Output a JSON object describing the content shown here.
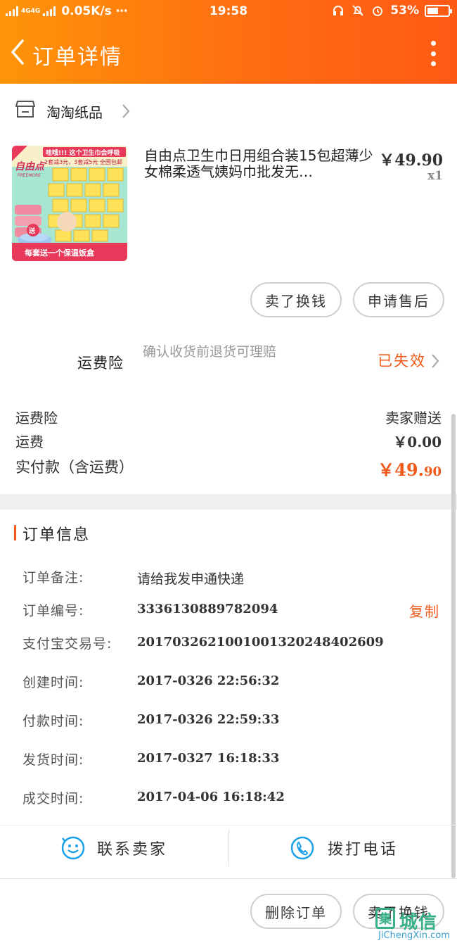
{
  "status_bar": {
    "net_top": "2G",
    "net_mid": "4G4G",
    "speed": "0.05K/s ⋯",
    "time": "19:58",
    "battery": "53%",
    "battery_level": 0.53
  },
  "nav": {
    "title": "订单详情"
  },
  "shop": {
    "name": "淘淘纸品"
  },
  "product": {
    "image_text_top": "哇哦!!! 这个卫生巾会呼吸",
    "image_text_mid": "2套减3元，3套减5元  全国包邮",
    "image_brand": "自由点",
    "image_brand_en": "FREEMORE",
    "image_badge": "送",
    "image_text_bottom": "每套送一个保温饭盒",
    "title": "自由点卫生巾日用组合装15包超薄少女棉柔透气姨妈巾批发无…",
    "price": "￥49.90",
    "qty": "x1"
  },
  "actions": {
    "sell_label": "卖了换钱",
    "after_sale_label": "申请售后"
  },
  "insurance": {
    "label": "运费险",
    "desc": "确认收货前退货可理赔",
    "status": "已失效"
  },
  "cost": {
    "insurance_label": "运费险",
    "insurance_value": "卖家赠送",
    "shipping_label": "运费",
    "shipping_value": "￥0.00",
    "total_label": "实付款（含运费）",
    "total_value_main": "￥49.",
    "total_value_decimal": "90"
  },
  "order_info": {
    "heading": "订单信息",
    "copy_label": "复制",
    "rows": [
      {
        "key": "订单备注:",
        "value": "请给我发申通快递"
      },
      {
        "key": "订单编号:",
        "value": "3336130889782094"
      },
      {
        "key": "支付宝交易号:",
        "value": "2017032621001001320248402609"
      },
      {
        "key": "创建时间:",
        "value": "2017-0326  22:56:32"
      },
      {
        "key": "付款时间:",
        "value": "2017-0326  22:59:33"
      },
      {
        "key": "发货时间:",
        "value": "2017-0327  16:18:33"
      },
      {
        "key": "成交时间:",
        "value": "2017-04-06  16:18:42"
      }
    ]
  },
  "contact": {
    "seller_label": "联系卖家",
    "phone_label": "拨打电话"
  },
  "bottom_actions": {
    "delete_label": "删除订单",
    "sell_label": "卖了换钱"
  },
  "watermark": {
    "box_char": "集",
    "text": "城信",
    "url": "JiChengXin.com"
  },
  "colors": {
    "header_start": "#ff9408",
    "header_end": "#ff5a14",
    "accent": "#f05a1a",
    "contact_icon": "#1aa0e8"
  }
}
